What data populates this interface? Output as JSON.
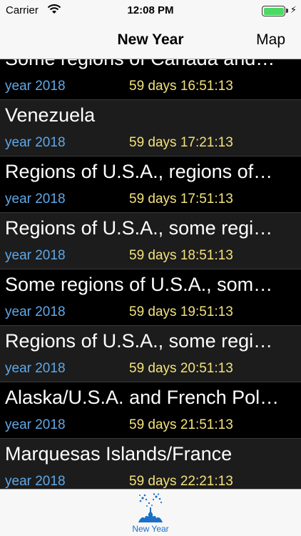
{
  "status": {
    "carrier": "Carrier",
    "time": "12:08 PM",
    "battery_level": 1.0,
    "icons": [
      "wifi-icon",
      "battery-icon",
      "charging-bolt-icon"
    ]
  },
  "nav": {
    "title": "New Year",
    "right_button": "Map"
  },
  "rows": [
    {
      "name": "Some regions of Canada and…",
      "year": "year 2018",
      "countdown": "59 days 16:51:13"
    },
    {
      "name": "Venezuela",
      "year": "year 2018",
      "countdown": "59 days 17:21:13"
    },
    {
      "name": "Regions of U.S.A., regions of…",
      "year": "year 2018",
      "countdown": "59 days 17:51:13"
    },
    {
      "name": "Regions of U.S.A., some regi…",
      "year": "year 2018",
      "countdown": "59 days 18:51:13"
    },
    {
      "name": "Some regions of U.S.A., som…",
      "year": "year 2018",
      "countdown": "59 days 19:51:13"
    },
    {
      "name": "Regions of U.S.A., some regi…",
      "year": "year 2018",
      "countdown": "59 days 20:51:13"
    },
    {
      "name": "Alaska/U.S.A. and French Pol…",
      "year": "year 2018",
      "countdown": "59 days 21:51:13"
    },
    {
      "name": "Marquesas Islands/France",
      "year": "year 2018",
      "countdown": "59 days 22:21:13"
    }
  ],
  "tabbar": {
    "items": [
      {
        "label": "New Year",
        "icon": "fireworks-icon",
        "selected": true
      }
    ]
  },
  "colors": {
    "year_text": "#5fa8e8",
    "countdown_text": "#f3e27a",
    "tab_selected": "#1b6fc6",
    "battery_fill": "#4cd964"
  }
}
